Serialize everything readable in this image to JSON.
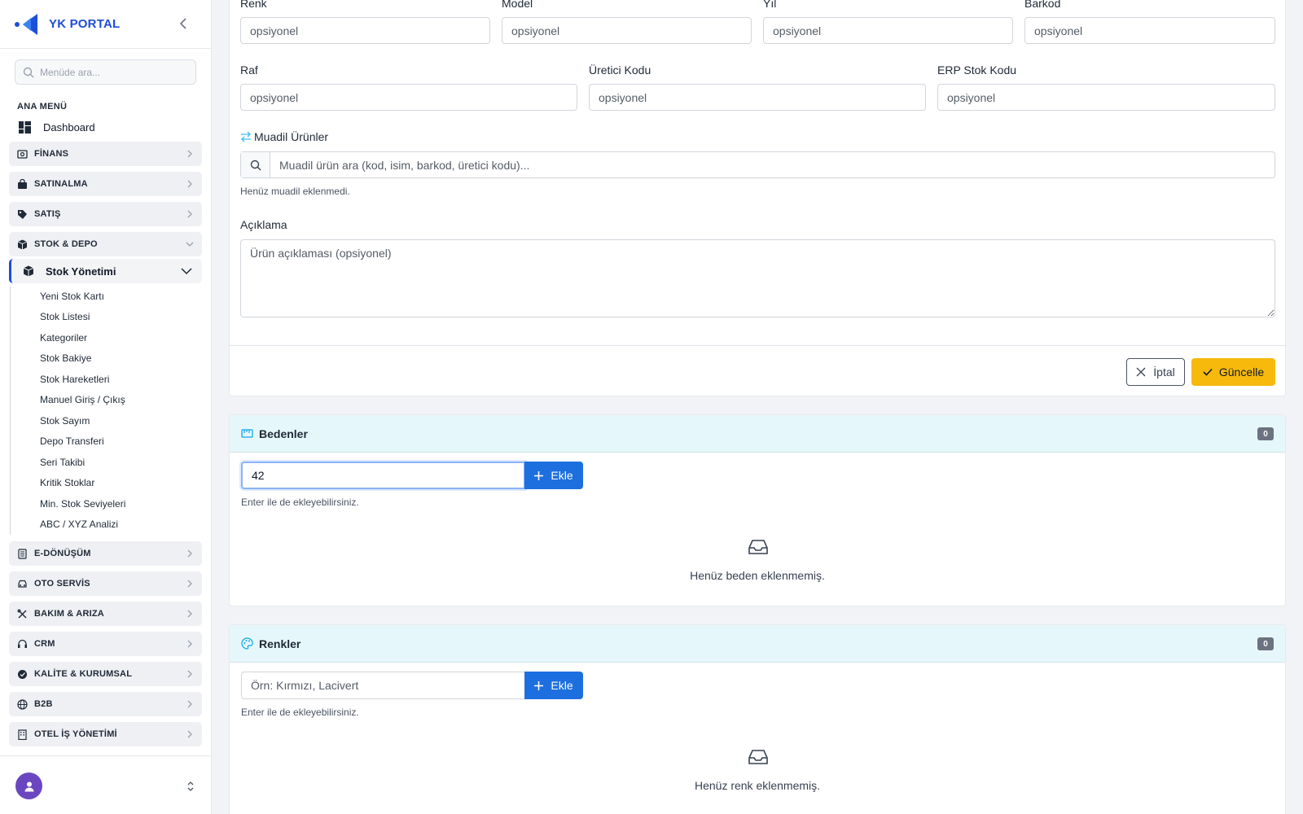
{
  "app": {
    "title": "YK PORTAL"
  },
  "sidebar": {
    "search_placeholder": "Menüde ara...",
    "section_title": "ANA MENÜ",
    "dashboard_label": "Dashboard",
    "groups": [
      {
        "label": "FİNANS",
        "icon": "finance-icon"
      },
      {
        "label": "SATINALMA",
        "icon": "bag-icon"
      },
      {
        "label": "SATIŞ",
        "icon": "tag-icon"
      },
      {
        "label": "STOK & DEPO",
        "icon": "box-icon",
        "expanded": true
      },
      {
        "label": "E-DÖNÜŞÜM",
        "icon": "document-icon"
      },
      {
        "label": "OTO SERVİS",
        "icon": "car-icon"
      },
      {
        "label": "BAKIM & ARIZA",
        "icon": "tools-icon"
      },
      {
        "label": "CRM",
        "icon": "headset-icon"
      },
      {
        "label": "KALİTE & KURUMSAL",
        "icon": "quality-badge-icon"
      },
      {
        "label": "B2B",
        "icon": "globe-icon"
      },
      {
        "label": "OTEL İŞ YÖNETİMİ",
        "icon": "building-icon"
      }
    ],
    "active_submenu": "Stok Yönetimi",
    "sub_items": [
      "Yeni Stok Kartı",
      "Stok Listesi",
      "Kategoriler",
      "Stok Bakiye",
      "Stok Hareketleri",
      "Manuel Giriş / Çıkış",
      "Stok Sayım",
      "Depo Transferi",
      "Seri Takibi",
      "Kritik Stoklar",
      "Min. Stok Seviyeleri",
      "ABC / XYZ Analizi"
    ]
  },
  "form": {
    "row1": [
      {
        "label": "Renk",
        "placeholder": "opsiyonel"
      },
      {
        "label": "Model",
        "placeholder": "opsiyonel"
      },
      {
        "label": "Yıl",
        "placeholder": "opsiyonel"
      },
      {
        "label": "Barkod",
        "placeholder": "opsiyonel"
      }
    ],
    "row2": [
      {
        "label": "Raf",
        "placeholder": "opsiyonel"
      },
      {
        "label": "Üretici Kodu",
        "placeholder": "opsiyonel"
      },
      {
        "label": "ERP Stok Kodu",
        "placeholder": "opsiyonel"
      }
    ],
    "muadil": {
      "label": "Muadil Ürünler",
      "placeholder": "Muadil ürün ara (kod, isim, barkod, üretici kodu)...",
      "note": "Henüz muadil eklenmedi."
    },
    "description": {
      "label": "Açıklama",
      "placeholder": "Ürün açıklaması (opsiyonel)"
    },
    "cancel_label": "İptal",
    "update_label": "Güncelle"
  },
  "sizes": {
    "title": "Bedenler",
    "count": "0",
    "input_value": "42",
    "add_label": "Ekle",
    "note": "Enter ile de ekleyebilirsiniz.",
    "empty_text": "Henüz beden eklenmemiş."
  },
  "colors": {
    "title": "Renkler",
    "count": "0",
    "input_placeholder": "Örn: Kırmızı, Lacivert",
    "add_label": "Ekle",
    "note": "Enter ile de ekleyebilirsiniz.",
    "empty_text": "Henüz renk eklenmemiş."
  },
  "theme": {
    "primary": "#1d6fe0",
    "warning": "#f6b90c",
    "section_header_bg": "#e6f7fb"
  }
}
